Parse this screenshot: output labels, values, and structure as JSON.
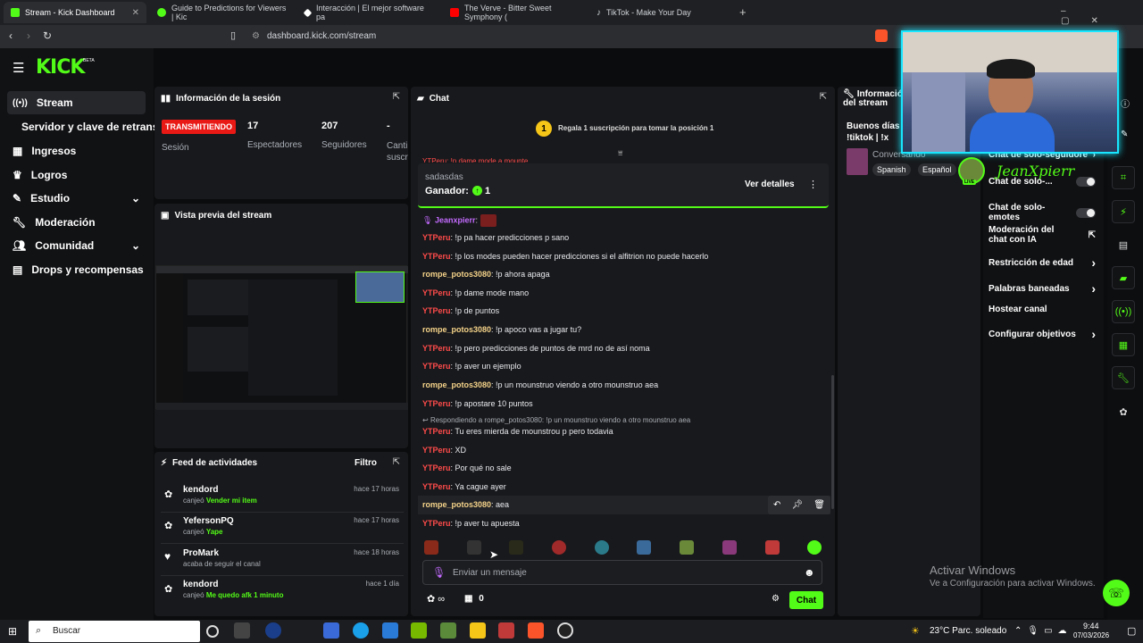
{
  "browser": {
    "tabs": [
      {
        "label": "Stream - Kick Dashboard",
        "active": true,
        "icon": "kick-icon"
      },
      {
        "label": "Guide to Predictions for Viewers | Kic",
        "active": false,
        "icon": "kick-icon"
      },
      {
        "label": "Interacción | El mejor software pa",
        "active": false,
        "icon": "diamond-icon"
      },
      {
        "label": "The Verve - Bitter Sweet Symphony (",
        "active": false,
        "icon": "youtube-icon"
      },
      {
        "label": "TikTok - Make Your Day",
        "active": false,
        "icon": "tiktok-icon"
      }
    ],
    "new_tab": "+",
    "url": "dashboard.kick.com/stream"
  },
  "app": {
    "logo": "KICK",
    "logo_badge": "BETA"
  },
  "sidebar": {
    "items": [
      {
        "label": "Stream",
        "icon": "broadcast-icon"
      },
      {
        "label": "Servidor y clave de retransm",
        "icon": ""
      },
      {
        "label": "Ingresos",
        "icon": "chart-icon"
      },
      {
        "label": "Logros",
        "icon": "trophy-icon"
      },
      {
        "label": "Estudio",
        "icon": "pen-icon"
      },
      {
        "label": "Moderación",
        "icon": "wrench-icon"
      },
      {
        "label": "Comunidad",
        "icon": "people-icon"
      },
      {
        "label": "Drops y recompensas",
        "icon": "gift-icon"
      }
    ]
  },
  "session": {
    "title": "Información de la sesión",
    "badge": "TRANSMITIENDO",
    "badge_label": "Sesión",
    "stats": [
      {
        "value": "17",
        "label": "Espectadores"
      },
      {
        "value": "207",
        "label": "Seguidores"
      },
      {
        "value": "-",
        "label": "Canti suscr"
      }
    ]
  },
  "preview": {
    "title": "Vista previa del stream"
  },
  "feed": {
    "title": "Feed de actividades",
    "filter": "Filtro",
    "items": [
      {
        "user": "kendord",
        "time": "hace 17 horas",
        "action": "canjeó",
        "detail": "Vender mi item"
      },
      {
        "user": "YefersonPQ",
        "time": "hace 17 horas",
        "action": "canjeó",
        "detail": "Yape"
      },
      {
        "user": "ProMark",
        "time": "hace 18 horas",
        "action": "acaba de seguir el canal",
        "detail": ""
      },
      {
        "user": "kendord",
        "time": "hace 1 día",
        "action": "canjeó",
        "detail": "Me quedo afk 1 minuto"
      }
    ]
  },
  "chat": {
    "title": "Chat",
    "gift_rank": "1",
    "gift_text": "Regala 1 suscripción para tomar la posición 1",
    "hidden_line": "YTPeru: !p dame mode a mounte",
    "prediction": {
      "name": "sadasdas",
      "winner_label": "Ganador:",
      "winner_value": "1",
      "details": "Ver detalles"
    },
    "messages": [
      {
        "user": "Jeanxpierr",
        "sep": ":",
        "text": ""
      },
      {
        "user": "YTPeru",
        "sep": ":",
        "text": " !p pa hacer predicciones p sano"
      },
      {
        "user": "YTPeru",
        "sep": ":",
        "text": " !p los modes pueden hacer predicciones si el alfitrion no puede hacerlo"
      },
      {
        "user": "rompe_potos3080",
        "sep": ":",
        "text": " !p ahora apaga"
      },
      {
        "user": "YTPeru",
        "sep": ":",
        "text": " !p dame mode mano"
      },
      {
        "user": "YTPeru",
        "sep": ":",
        "text": " !p de puntos"
      },
      {
        "user": "rompe_potos3080",
        "sep": ":",
        "text": " !p apoco vas a jugar tu?"
      },
      {
        "user": "YTPeru",
        "sep": ":",
        "text": " !p pero predicciones de puntos de mrd no de así noma"
      },
      {
        "user": "YTPeru",
        "sep": ":",
        "text": " !p aver un ejemplo"
      },
      {
        "user": "rompe_potos3080",
        "sep": ":",
        "text": " !p un mounstruo viendo a otro mounstruo aea"
      },
      {
        "user": "YTPeru",
        "sep": ":",
        "text": " !p apostare 10 puntos"
      },
      {
        "user": "YTPeru",
        "sep": ":",
        "text": " Tu eres mierda de mounstrou p pero todavia"
      },
      {
        "user": "YTPeru",
        "sep": ":",
        "text": " XD"
      },
      {
        "user": "YTPeru",
        "sep": ":",
        "text": " Por qué no sale"
      },
      {
        "user": "YTPeru",
        "sep": ":",
        "text": " Ya cague ayer"
      },
      {
        "user": "rompe_potos3080",
        "sep": ":",
        "text": " aea"
      },
      {
        "user": "YTPeru",
        "sep": ":",
        "text": " !p aver tu apuesta"
      }
    ],
    "reply_context": "Respondiendo a rompe_potos3080: !p un mounstruo viendo a otro mounstruo aea",
    "input_placeholder": "Enviar un mensaje",
    "points": "∞",
    "gifts_count": "0",
    "send_label": "Chat"
  },
  "stream_info": {
    "title": "Información del stream",
    "stream_title": "Buenos días !tiktok | !x",
    "category": "Conversando",
    "tags": [
      "Spanish",
      "Español"
    ]
  },
  "webcam": {
    "overlay_name": "JeanXpierr",
    "live": "LIVE"
  },
  "settings": [
    {
      "label": "Chat de solo-seguidore",
      "control": "chevron"
    },
    {
      "label": "Chat de solo-...",
      "control": "toggle"
    },
    {
      "label": "Chat de solo-emotes",
      "control": "toggle"
    },
    {
      "label": "Moderación del chat con IA",
      "control": "external"
    },
    {
      "label": "Restricción de edad",
      "control": "chevron"
    },
    {
      "label": "Palabras baneadas",
      "control": "chevron"
    },
    {
      "label": "Hostear canal",
      "control": "none"
    },
    {
      "label": "Configurar objetivos",
      "control": "chevron"
    }
  ],
  "windows": {
    "activate_title": "Activar Windows",
    "activate_sub": "Ve a Configuración para activar Windows.",
    "search": "Buscar",
    "weather": "23°C  Parc. soleado",
    "time": "9:44",
    "date": "07/03/2026"
  }
}
